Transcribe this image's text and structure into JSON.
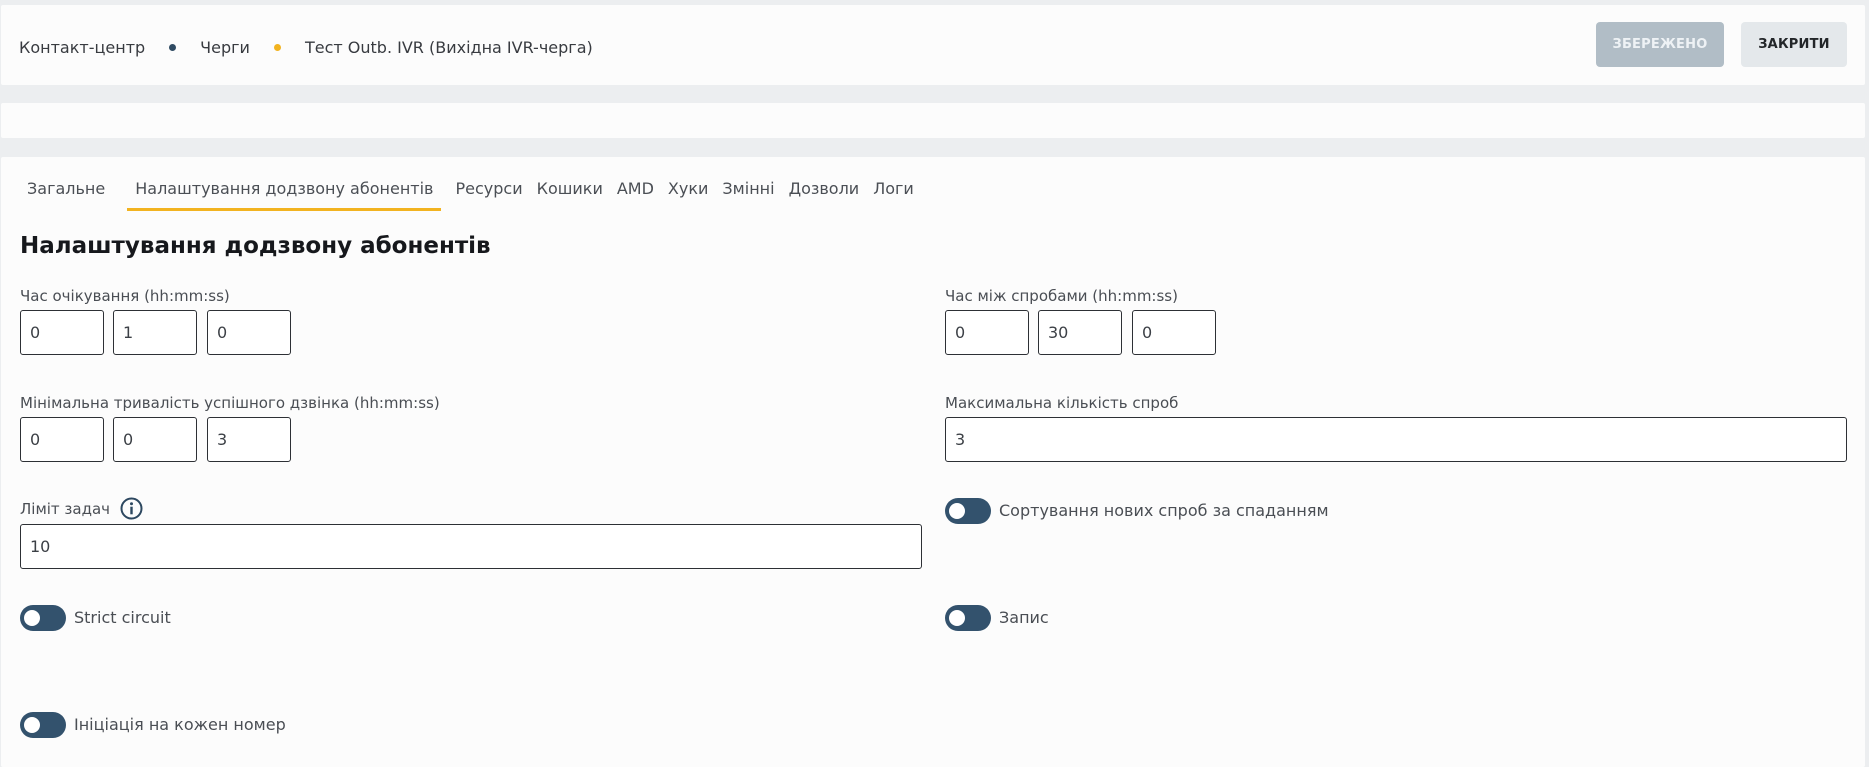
{
  "breadcrumb": {
    "items": [
      "Контакт-центр",
      "Черги",
      "Тест Outb. IVR (Вихідна IVR-черга)"
    ],
    "separator_colors": [
      "#2f4a62",
      "#f2b320"
    ]
  },
  "actions": {
    "saved_label": "ЗБЕРЕЖЕНО",
    "close_label": "ЗАКРИТИ"
  },
  "tabs": [
    {
      "label": "Загальне",
      "active": false
    },
    {
      "label": "Налаштування додзвону абонентів",
      "active": true
    },
    {
      "label": "Ресурси",
      "active": false
    },
    {
      "label": "Кошики",
      "active": false
    },
    {
      "label": "AMD",
      "active": false
    },
    {
      "label": "Хуки",
      "active": false
    },
    {
      "label": "Змінні",
      "active": false
    },
    {
      "label": "Дозволи",
      "active": false
    },
    {
      "label": "Логи",
      "active": false
    }
  ],
  "section_title": "Налаштування додзвону абонентів",
  "fields": {
    "wait_time": {
      "label": "Час очікування (hh:mm:ss)",
      "values": [
        "0",
        "1",
        "0"
      ]
    },
    "retry_interval": {
      "label": "Час між спробами (hh:mm:ss)",
      "values": [
        "0",
        "30",
        "0"
      ]
    },
    "min_success_duration": {
      "label": "Мінімальна тривалість успішного дзвінка (hh:mm:ss)",
      "values": [
        "0",
        "0",
        "3"
      ]
    },
    "max_attempts": {
      "label": "Максимальна кількість спроб",
      "value": "3"
    },
    "task_limit": {
      "label": "Ліміт задач",
      "value": "10",
      "icon": "info-icon"
    }
  },
  "toggles": {
    "sort_desc": {
      "label": "Сортування нових спроб за спаданням"
    },
    "strict_circuit": {
      "label": "Strict circuit"
    },
    "recording": {
      "label": "Запис"
    },
    "per_number": {
      "label": "Ініціація на кожен номер"
    }
  },
  "colors": {
    "accent": "#f2b320",
    "toggle": "#33526d",
    "saved_button": "#b1bdc6",
    "close_button": "#e4e8eb"
  }
}
